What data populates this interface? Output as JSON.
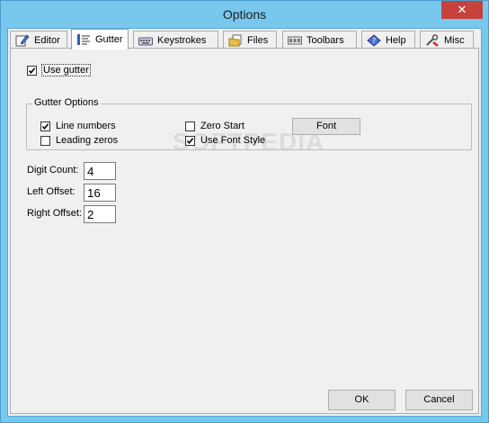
{
  "window": {
    "title": "Options",
    "close_glyph": "✕"
  },
  "tabs": [
    {
      "label": "Editor",
      "icon": "pencil-icon"
    },
    {
      "label": "Gutter",
      "icon": "gutter-icon",
      "active": true
    },
    {
      "label": "Keystrokes",
      "icon": "keyboard-icon"
    },
    {
      "label": "Files",
      "icon": "files-icon"
    },
    {
      "label": "Toolbars",
      "icon": "toolbar-icon"
    },
    {
      "label": "Help",
      "icon": "help-icon"
    },
    {
      "label": "Misc",
      "icon": "tools-icon"
    }
  ],
  "gutter": {
    "use_gutter": {
      "label": "Use gutter",
      "checked": true
    },
    "options_group": {
      "title": "Gutter Options",
      "line_numbers": {
        "label": "Line numbers",
        "checked": true
      },
      "leading_zeros": {
        "label": "Leading zeros",
        "checked": false
      },
      "zero_start": {
        "label": "Zero Start",
        "checked": false
      },
      "use_font_style": {
        "label": "Use Font Style",
        "checked": true
      },
      "font_button": "Font"
    },
    "digit_count": {
      "label": "Digit Count:",
      "value": "4"
    },
    "left_offset": {
      "label": "Left Offset:",
      "value": "16"
    },
    "right_offset": {
      "label": "Right Offset:",
      "value": "2"
    }
  },
  "buttons": {
    "ok": "OK",
    "cancel": "Cancel"
  },
  "watermark": "SOFTPEDIA"
}
